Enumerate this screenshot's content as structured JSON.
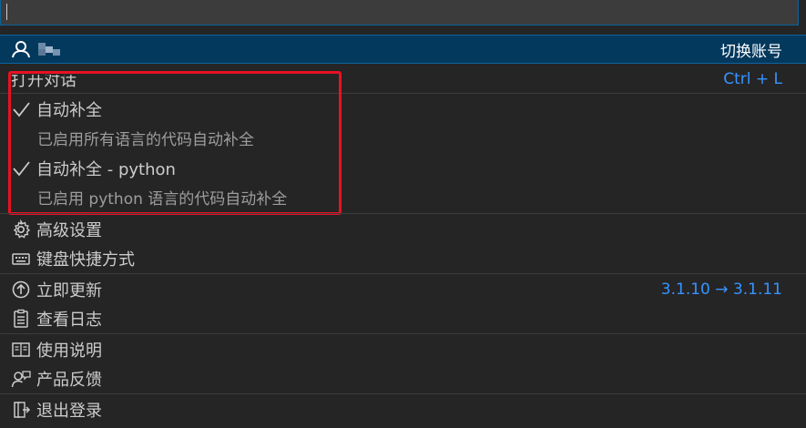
{
  "colors": {
    "background": "#252526",
    "selected_row": "#04395e",
    "accent": "#3794ff",
    "annotation_box": "#e81123",
    "subtext": "#9d9d9d"
  },
  "account": {
    "icon": "account-icon",
    "action_label": "切换账号"
  },
  "open_chat": {
    "label": "打开对话",
    "shortcut": "Ctrl + L"
  },
  "completions": [
    {
      "icon": "check-icon",
      "label": "自动补全",
      "description": "已启用所有语言的代码自动补全"
    },
    {
      "icon": "check-icon",
      "label": "自动补全 - python",
      "description": "已启用 python 语言的代码自动补全"
    }
  ],
  "settings_items": [
    {
      "icon": "gear-icon",
      "label": "高级设置"
    },
    {
      "icon": "keyboard-icon",
      "label": "键盘快捷方式"
    }
  ],
  "update": {
    "icon": "arrow-up-circle-icon",
    "label": "立即更新",
    "version_info": "3.1.10 → 3.1.11"
  },
  "log": {
    "icon": "log-icon",
    "label": "查看日志"
  },
  "help_items": [
    {
      "icon": "book-icon",
      "label": "使用说明"
    },
    {
      "icon": "feedback-icon",
      "label": "产品反馈"
    }
  ],
  "logout": {
    "icon": "sign-out-icon",
    "label": "退出登录"
  }
}
